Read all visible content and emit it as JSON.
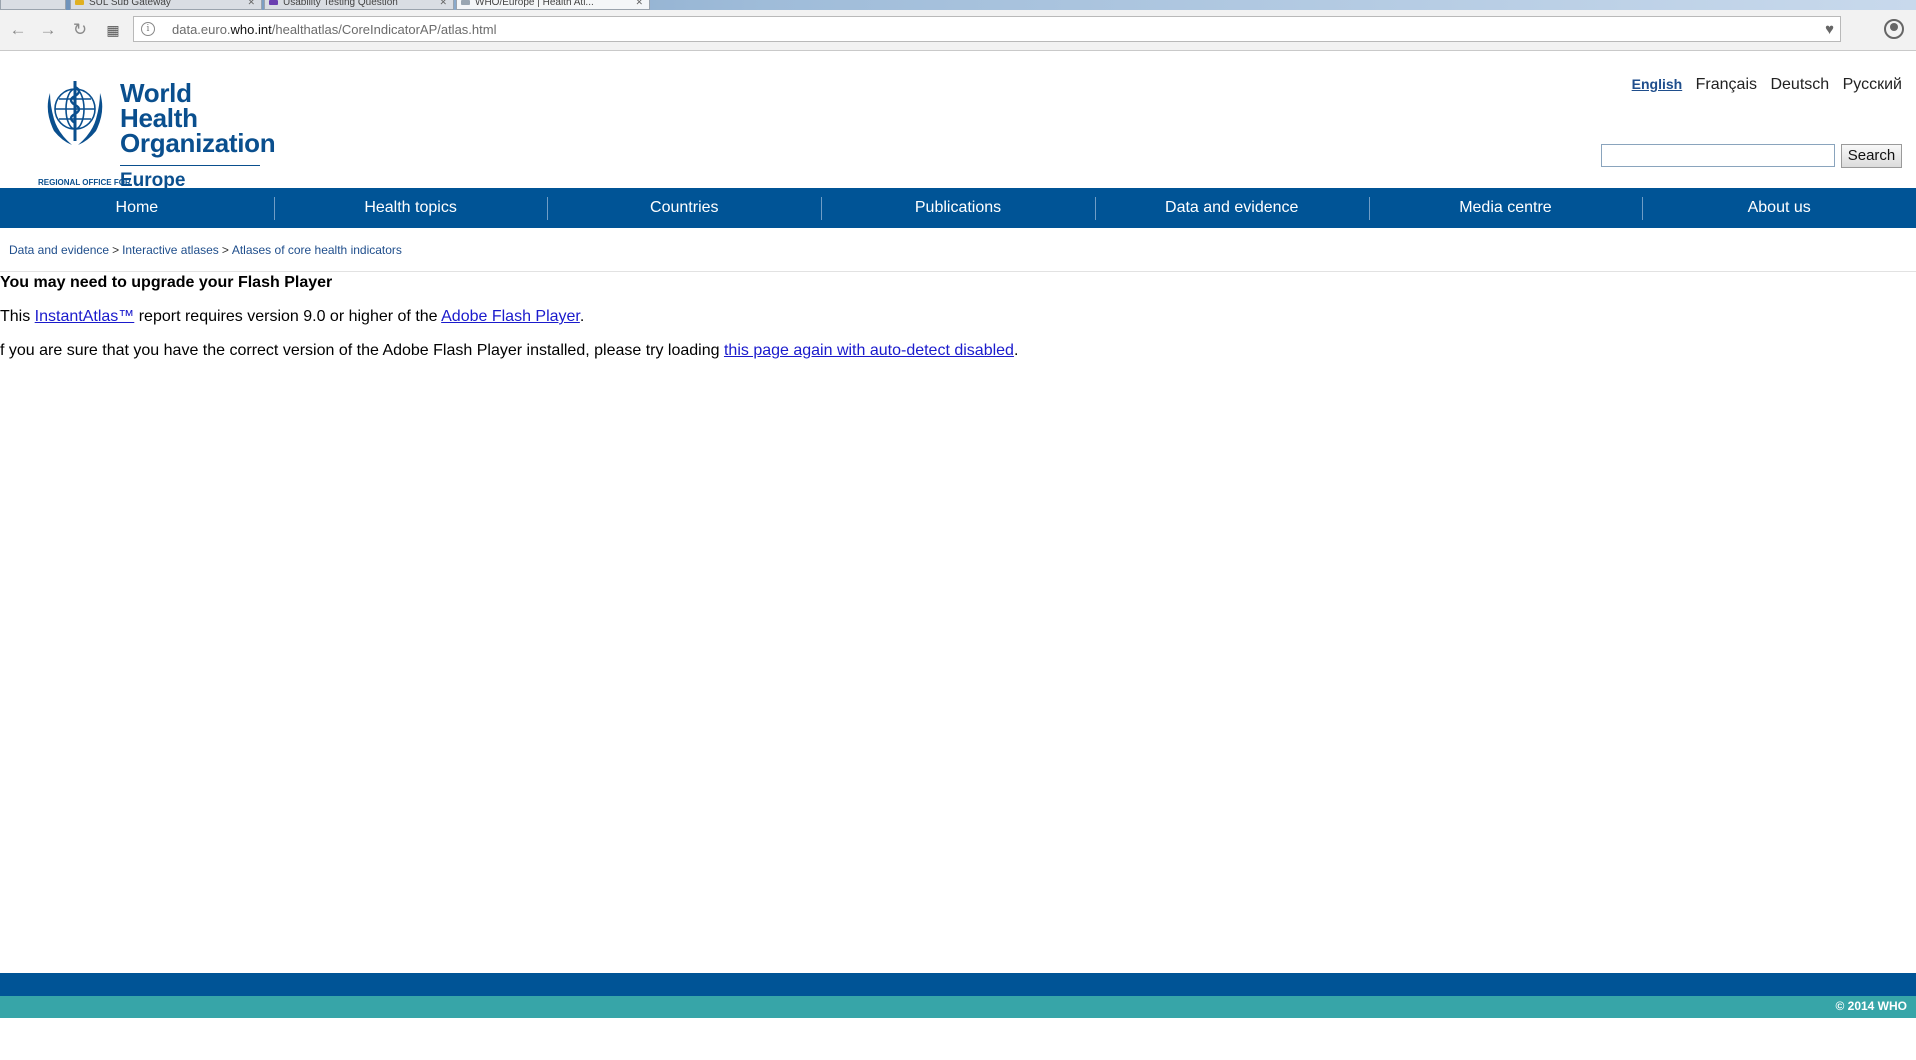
{
  "browser": {
    "tabs": [
      {
        "label": "",
        "active": false
      },
      {
        "label": "SUL Sub Gateway",
        "active": false
      },
      {
        "label": "Usability Testing Question",
        "active": false
      },
      {
        "label": "WHO/Europe | Health Atl...",
        "active": true
      }
    ],
    "url_prefix": "data.euro.",
    "url_domain": "who.int",
    "url_path": "/healthatlas/CoreIndicatorAP/atlas.html"
  },
  "header": {
    "org_line1": "World Health",
    "org_line2": "Organization",
    "regional_office": "REGIONAL OFFICE FOR",
    "region": "Europe",
    "languages": [
      "English",
      "Français",
      "Deutsch",
      "Русский"
    ],
    "active_language": "English",
    "search_value": "",
    "search_button": "Search"
  },
  "nav": {
    "items": [
      "Home",
      "Health topics",
      "Countries",
      "Publications",
      "Data and evidence",
      "Media centre",
      "About us"
    ]
  },
  "breadcrumb": {
    "items": [
      "Data and evidence",
      "Interactive atlases",
      "Atlases of core health indicators"
    ],
    "separator": ">"
  },
  "content": {
    "heading": "You may need to upgrade your Flash Player",
    "p1_before": "This ",
    "p1_link1": "InstantAtlas™",
    "p1_middle": " report requires version 9.0 or higher of the ",
    "p1_link2": "Adobe Flash Player",
    "p1_after": ".",
    "p2_before": "f you are sure that you have the correct version of the Adobe Flash Player installed, please try loading ",
    "p2_link": "this page again with auto-detect disabled",
    "p2_after": "."
  },
  "footer": {
    "copyright": "© 2014 WHO"
  },
  "colors": {
    "nav_bg": "#005496",
    "footer_teal": "#37a5a8",
    "link": "#1a1acc",
    "who_blue": "#0a4f8e"
  }
}
